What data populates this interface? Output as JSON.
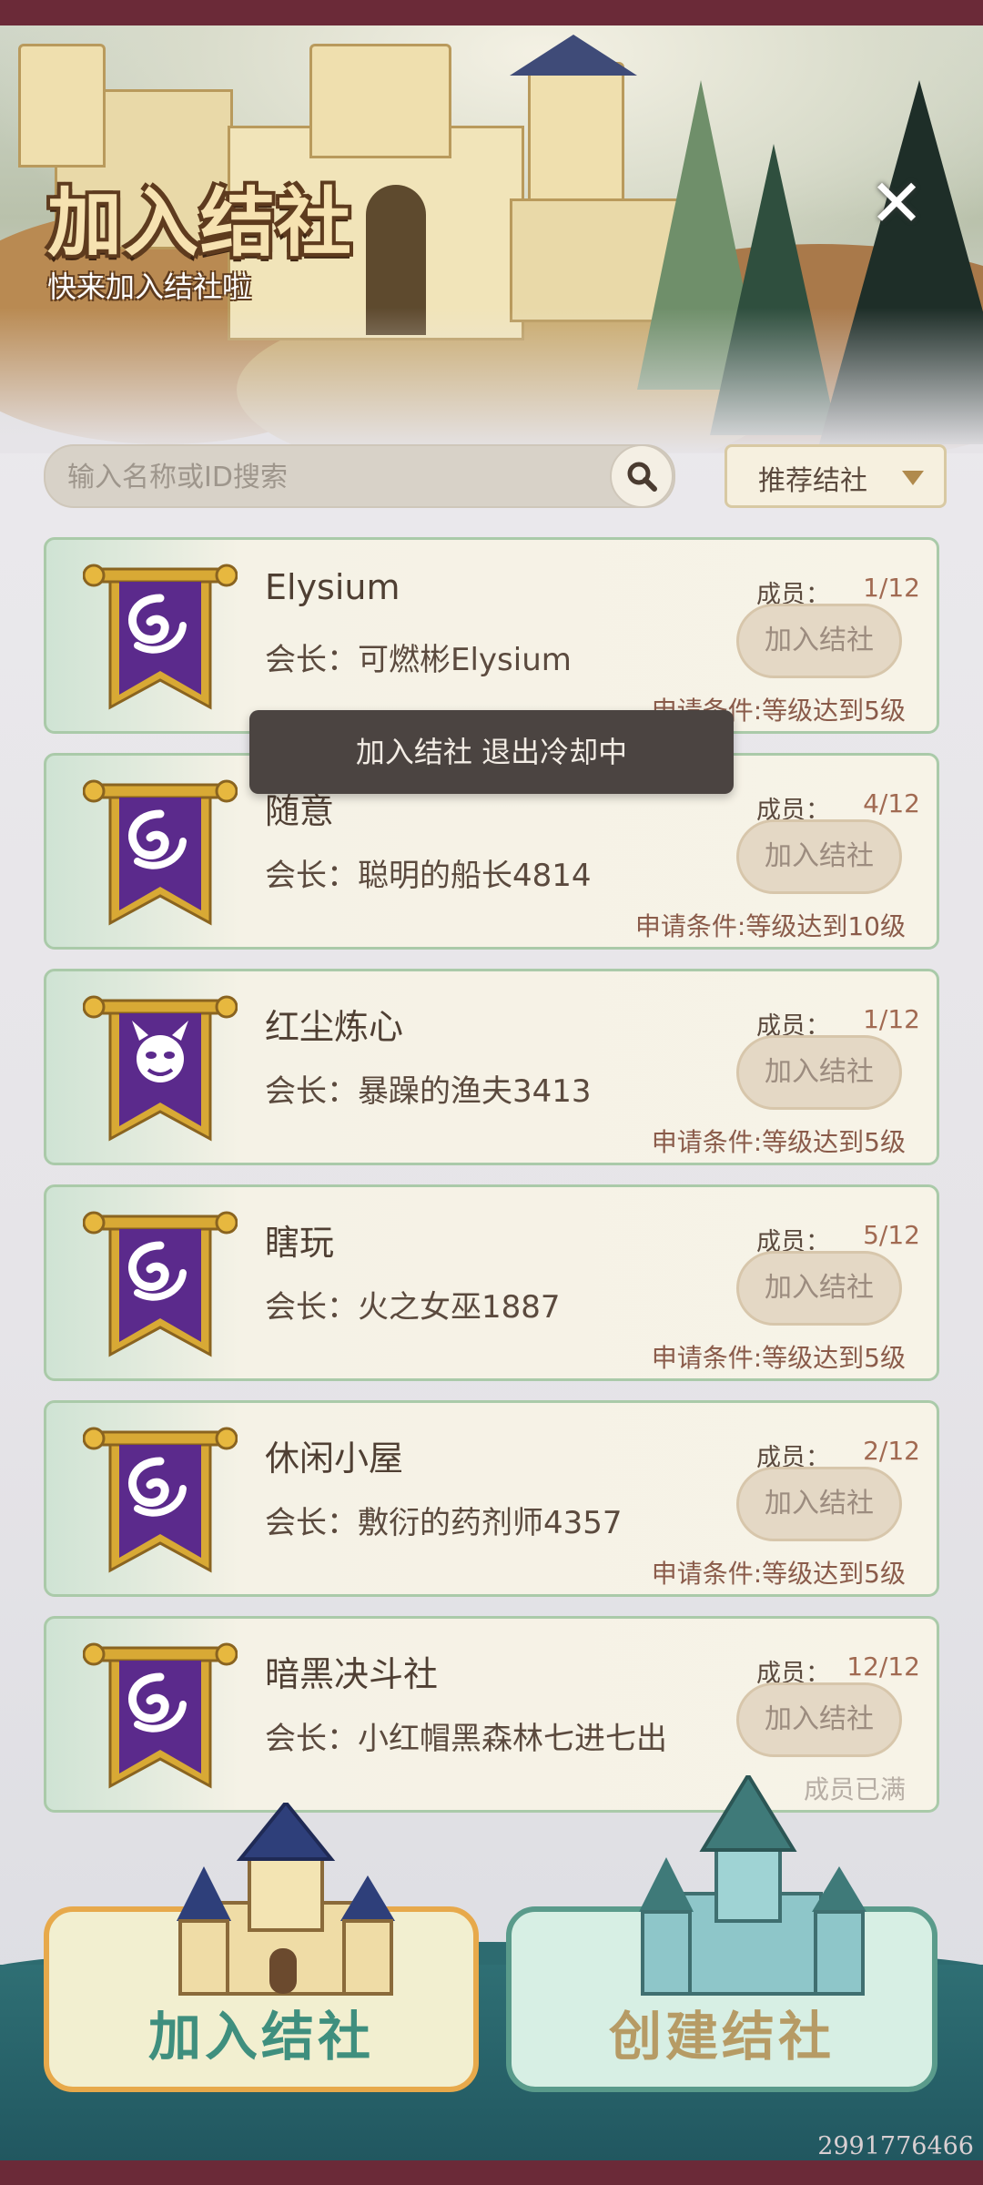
{
  "header": {
    "title": "加入结社",
    "subtitle": "快来加入结社啦",
    "close_symbol": "✕"
  },
  "search": {
    "placeholder": "输入名称或ID搜索",
    "icon": "search-icon"
  },
  "filter": {
    "label": "推荐结社",
    "icon": "triangle-down-icon"
  },
  "labels": {
    "leader_prefix": "会长：",
    "members_prefix": "成员：",
    "join_button": "加入结社"
  },
  "guilds": [
    {
      "name": "Elysium",
      "leader": "可燃彬Elysium",
      "members": "1/12",
      "requirement": "申请条件:等级达到5级",
      "emblem": "swirl-emblem-icon"
    },
    {
      "name": "随意",
      "leader": "聪明的船长4814",
      "members": "4/12",
      "requirement": "申请条件:等级达到10级",
      "emblem": "swirl-emblem-icon"
    },
    {
      "name": "红尘炼心",
      "leader": "暴躁的渔夫3413",
      "members": "1/12",
      "requirement": "申请条件:等级达到5级",
      "emblem": "demon-emblem-icon"
    },
    {
      "name": "瞎玩",
      "leader": "火之女巫1887",
      "members": "5/12",
      "requirement": "申请条件:等级达到5级",
      "emblem": "swirl-emblem-icon"
    },
    {
      "name": "休闲小屋",
      "leader": "敷衍的药剂师4357",
      "members": "2/12",
      "requirement": "申请条件:等级达到5级",
      "emblem": "swirl-emblem-icon"
    },
    {
      "name": "暗黑决斗社",
      "leader": "小红帽黑森林七进七出",
      "members": "12/12",
      "requirement": "成员已满",
      "emblem": "swirl-emblem-icon"
    }
  ],
  "toast": "加入结社 退出冷却中",
  "bottom": {
    "join_label": "加入结社",
    "create_label": "创建结社"
  },
  "user_id": "2991776466",
  "colors": {
    "card_border": "#aacaa9",
    "banner_purple": "#5b2a8c",
    "gold": "#d8a935",
    "join_accent": "#e7a94b",
    "create_accent": "#5a9b8b"
  }
}
